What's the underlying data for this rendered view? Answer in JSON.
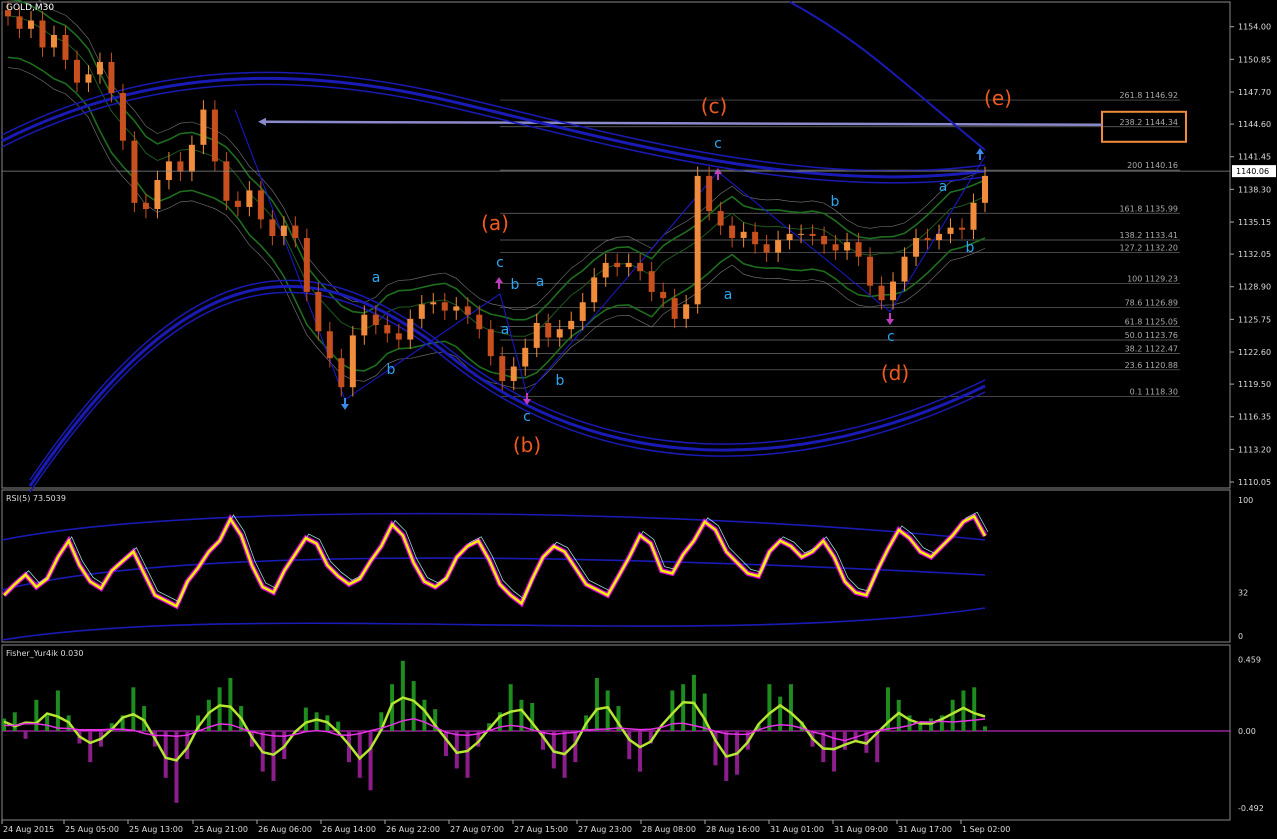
{
  "chart_data": {
    "type": "line",
    "symbol_title": "GOLD,M30",
    "colors": {
      "background": "#000000",
      "candle_up": "#f08c3c",
      "candle_down": "#c8501e",
      "wave_label_orange": "#f05a1e",
      "wave_label_cyan": "#2aa8f0",
      "fib_line": "#6e6e6e",
      "grid_band_blue": "#1a1ab4",
      "green_band": "#1e6e1e",
      "rsi_line": "#f0f000",
      "rsi_glow": "#e000e0",
      "fisher_hist_up": "#1e8c1e",
      "fisher_hist_down": "#8c1e8c",
      "fisher_signal": "#b4e632",
      "fisher_trigger": "#e632e6"
    },
    "price_axis": {
      "ticks": [
        "1154.00",
        "1150.85",
        "1147.70",
        "1144.60",
        "1141.45",
        "1138.30",
        "1135.15",
        "1132.05",
        "1128.90",
        "1125.75",
        "1122.60",
        "1119.50",
        "1116.35",
        "1113.20",
        "1110.05"
      ],
      "current": "1140.06",
      "ylim": [
        1110.05,
        1156.0
      ]
    },
    "time_axis": {
      "ticks": [
        "24 Aug 2015",
        "25 Aug 05:00",
        "25 Aug 13:00",
        "25 Aug 21:00",
        "26 Aug 06:00",
        "26 Aug 14:00",
        "26 Aug 22:00",
        "27 Aug 07:00",
        "27 Aug 15:00",
        "27 Aug 23:00",
        "28 Aug 08:00",
        "28 Aug 16:00",
        "31 Aug 01:00",
        "31 Aug 09:00",
        "31 Aug 17:00",
        "1 Sep 02:00"
      ]
    },
    "fib_levels": [
      {
        "label": "261.8 1146.92",
        "price": 1146.92
      },
      {
        "label": "238.2 1144.34",
        "price": 1144.34
      },
      {
        "label": "200 1140.16",
        "price": 1140.16
      },
      {
        "label": "161.8 1135.99",
        "price": 1135.99
      },
      {
        "label": "138.2 1133.41",
        "price": 1133.41
      },
      {
        "label": "127.2 1132.20",
        "price": 1132.2
      },
      {
        "label": "100 1129.23",
        "price": 1129.23
      },
      {
        "label": "78.6 1126.89",
        "price": 1126.89
      },
      {
        "label": "61.8 1125.05",
        "price": 1125.05
      },
      {
        "label": "50.0 1123.76",
        "price": 1123.76
      },
      {
        "label": "38.2 1122.47",
        "price": 1122.47
      },
      {
        "label": "23.6 1120.88",
        "price": 1120.88
      },
      {
        "label": "0.1 1118.30",
        "price": 1118.3
      }
    ],
    "wave_labels_major": [
      "(a)",
      "(b)",
      "(c)",
      "(d)",
      "(e)"
    ],
    "wave_labels_minor": [
      "a",
      "b",
      "c",
      "a",
      "b",
      "c",
      "a",
      "b",
      "c",
      "a",
      "b",
      "c",
      "a",
      "b",
      "c"
    ],
    "candles_close": [
      1155.0,
      1153.8,
      1154.6,
      1152.0,
      1153.2,
      1150.8,
      1148.6,
      1149.4,
      1150.6,
      1147.6,
      1143.0,
      1137.0,
      1136.4,
      1139.2,
      1141.0,
      1140.0,
      1142.6,
      1146.0,
      1141.0,
      1137.2,
      1136.6,
      1138.2,
      1135.4,
      1133.8,
      1134.8,
      1133.6,
      1128.4,
      1124.6,
      1122.0,
      1119.2,
      1124.2,
      1126.2,
      1125.2,
      1124.4,
      1123.8,
      1125.8,
      1127.2,
      1127.4,
      1126.6,
      1127.0,
      1126.2,
      1124.8,
      1122.2,
      1119.8,
      1121.2,
      1123.0,
      1125.4,
      1124.0,
      1124.8,
      1125.6,
      1127.4,
      1129.8,
      1131.2,
      1130.8,
      1131.2,
      1130.4,
      1128.4,
      1127.8,
      1125.8,
      1127.2,
      1139.6,
      1136.2,
      1134.8,
      1133.6,
      1134.2,
      1133.0,
      1132.2,
      1133.4,
      1134.0,
      1134.0,
      1133.8,
      1133.0,
      1132.4,
      1133.2,
      1131.8,
      1129.0,
      1127.6,
      1129.4,
      1131.8,
      1133.6,
      1133.4,
      1134.0,
      1134.6,
      1134.4,
      1137.0,
      1139.6
    ],
    "rsi": {
      "title": "RSI(5) 73.5039",
      "ticks": [
        "100",
        "32",
        "0"
      ],
      "values": [
        30,
        38,
        45,
        36,
        42,
        58,
        70,
        52,
        40,
        35,
        48,
        55,
        62,
        46,
        30,
        26,
        22,
        40,
        50,
        62,
        70,
        86,
        74,
        52,
        36,
        32,
        48,
        60,
        72,
        68,
        52,
        44,
        38,
        42,
        55,
        66,
        82,
        74,
        54,
        40,
        36,
        42,
        58,
        66,
        70,
        56,
        38,
        30,
        24,
        42,
        58,
        66,
        62,
        50,
        38,
        34,
        30,
        44,
        58,
        74,
        68,
        48,
        46,
        60,
        70,
        84,
        78,
        62,
        54,
        46,
        44,
        62,
        70,
        66,
        58,
        62,
        70,
        58,
        40,
        32,
        30,
        48,
        64,
        78,
        72,
        62,
        58,
        66,
        74,
        84,
        88,
        73.5
      ]
    },
    "fisher": {
      "title": "Fisher_Yur4ik 0.030",
      "ticks": [
        "0.459",
        "0.00",
        "-0.492"
      ],
      "values": [
        0.08,
        0.12,
        -0.05,
        0.2,
        0.1,
        0.26,
        0.1,
        -0.08,
        -0.2,
        -0.1,
        0.05,
        0.1,
        0.28,
        0.16,
        -0.1,
        -0.3,
        -0.46,
        -0.18,
        0.1,
        0.2,
        0.28,
        0.34,
        0.16,
        -0.1,
        -0.26,
        -0.32,
        -0.18,
        0.0,
        0.15,
        0.12,
        0.1,
        0.06,
        -0.2,
        -0.3,
        -0.38,
        0.12,
        0.3,
        0.45,
        0.32,
        0.2,
        0.14,
        -0.16,
        -0.24,
        -0.3,
        -0.1,
        0.05,
        0.12,
        0.3,
        0.2,
        0.18,
        -0.12,
        -0.24,
        -0.3,
        -0.2,
        0.1,
        0.34,
        0.26,
        0.16,
        -0.18,
        -0.26,
        -0.08,
        0.0,
        0.26,
        0.3,
        0.36,
        0.24,
        -0.22,
        -0.32,
        -0.28,
        -0.12,
        0.04,
        0.3,
        0.22,
        0.3,
        0.06,
        -0.1,
        -0.2,
        -0.26,
        -0.12,
        -0.06,
        -0.14,
        -0.2,
        0.28,
        0.2,
        0.1,
        0.06,
        0.08,
        0.1,
        0.2,
        0.26,
        0.28,
        0.03
      ]
    }
  }
}
